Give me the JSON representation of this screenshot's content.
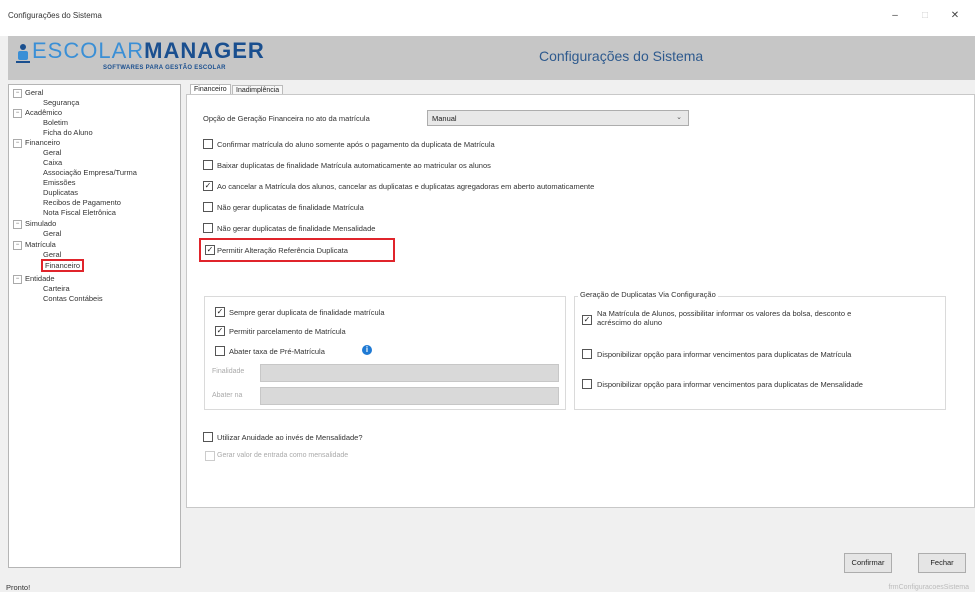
{
  "window": {
    "title": "Configurações do Sistema",
    "minimize_label": "–",
    "maximize_label": "□",
    "close_label": "✕"
  },
  "header": {
    "logo_part1": "ESCOLAR",
    "logo_part2": "MANAGER",
    "logo_subtitle": "SOFTWARES PARA GESTÃO ESCOLAR",
    "page_title": "Configurações do Sistema"
  },
  "tree": {
    "items": [
      {
        "label": "Geral",
        "expander": "−"
      },
      {
        "label": "Segurança"
      },
      {
        "label": "Acadêmico",
        "expander": "−"
      },
      {
        "label": "Boletim"
      },
      {
        "label": "Ficha do Aluno"
      },
      {
        "label": "Financeiro",
        "expander": "−"
      },
      {
        "label": "Geral"
      },
      {
        "label": "Caixa"
      },
      {
        "label": "Associação Empresa/Turma"
      },
      {
        "label": "Emissões"
      },
      {
        "label": "Duplicatas"
      },
      {
        "label": "Recibos de Pagamento"
      },
      {
        "label": "Nota Fiscal Eletrônica"
      },
      {
        "label": "Simulado",
        "expander": "−"
      },
      {
        "label": "Geral"
      },
      {
        "label": "Matrícula",
        "expander": "−"
      },
      {
        "label": "Geral"
      },
      {
        "label": "Financeiro"
      },
      {
        "label": "Entidade",
        "expander": "−"
      },
      {
        "label": "Carteira"
      },
      {
        "label": "Contas Contábeis"
      }
    ]
  },
  "tabs": {
    "financeiro": "Financeiro",
    "inadimplencia": "Inadimplência"
  },
  "form": {
    "geracao_label": "Opção de Geração Financeira no ato da matrícula",
    "geracao_value": "Manual",
    "options": [
      {
        "label": "Confirmar matrícula do aluno somente após o pagamento da duplicata de Matrícula",
        "checked": ""
      },
      {
        "label": "Baixar duplicatas de finalidade Matrícula automaticamente ao matricular os alunos",
        "checked": ""
      },
      {
        "label": "Ao cancelar a Matrícula dos alunos, cancelar as duplicatas e duplicatas agregadoras em aberto automaticamente",
        "checked": "✓"
      },
      {
        "label": "Não gerar duplicatas de finalidade Matrícula",
        "checked": ""
      },
      {
        "label": "Não gerar duplicatas de finalidade Mensalidade",
        "checked": ""
      },
      {
        "label": "Permitir Alteração Referência Duplicata",
        "checked": "✓"
      }
    ],
    "left_group": {
      "items": [
        {
          "label": "Sempre gerar duplicata de finalidade matrícula",
          "checked": "✓"
        },
        {
          "label": "Permitir parcelamento de Matrícula",
          "checked": "✓"
        },
        {
          "label": "Abater taxa de Pré-Matrícula",
          "checked": ""
        }
      ],
      "info_icon": "i",
      "finalidade_label": "Finalidade",
      "abater_label": "Abater na"
    },
    "right_group": {
      "title": "Geração de Duplicatas Via Configuração",
      "items": [
        {
          "label_line1": "Na Matrícula de Alunos, possibilitar informar os valores da bolsa, desconto e",
          "label_line2": "acréscimo do aluno",
          "checked": "✓"
        },
        {
          "label_line1": "Disponibilizar opção para informar vencimentos para duplicatas de Matrícula",
          "checked": ""
        },
        {
          "label_line1": "Disponibilizar opção para informar vencimentos para duplicatas de Mensalidade",
          "checked": ""
        }
      ]
    },
    "anuidade_label": "Utilizar Anuidade ao invés de Mensalidade?",
    "entrada_label": "Gerar valor de entrada como mensalidade"
  },
  "buttons": {
    "confirmar": "Confirmar",
    "fechar": "Fechar"
  },
  "status": {
    "left": "Pronto!",
    "right": "frmConfiguracoesSistema"
  },
  "colors": {
    "highlight": "#e0242b",
    "header_bg": "#c6c6c6",
    "brand_blue": "#1a4f8f",
    "info_blue": "#1f7ad4"
  }
}
